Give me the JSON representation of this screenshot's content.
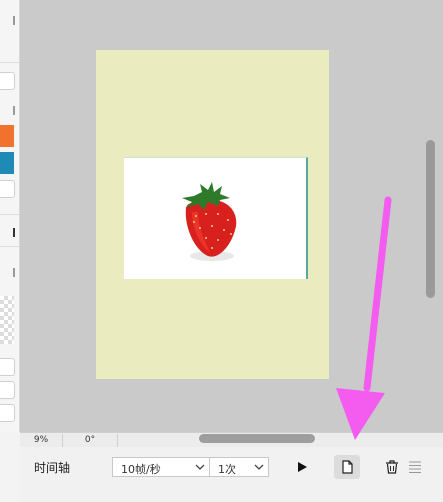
{
  "status_bar": {
    "zoom": "9%",
    "rotation": "0°"
  },
  "timeline": {
    "label": "时间轴",
    "fps_select": {
      "value": "10帧/秒"
    },
    "loop_select": {
      "value": "1次"
    }
  },
  "icons": {
    "play": "play-icon",
    "new_frame": "new-frame-icon",
    "delete": "trash-icon",
    "menu": "menu-lines-icon",
    "dropdown": "chevron-down-icon"
  },
  "colors": {
    "artboard": "#eaecbf",
    "canvas_bg": "#cacacb",
    "annotation_arrow": "#f45cf0",
    "swatch_orange": "#f0722c",
    "swatch_blue": "#1f8ab5"
  }
}
